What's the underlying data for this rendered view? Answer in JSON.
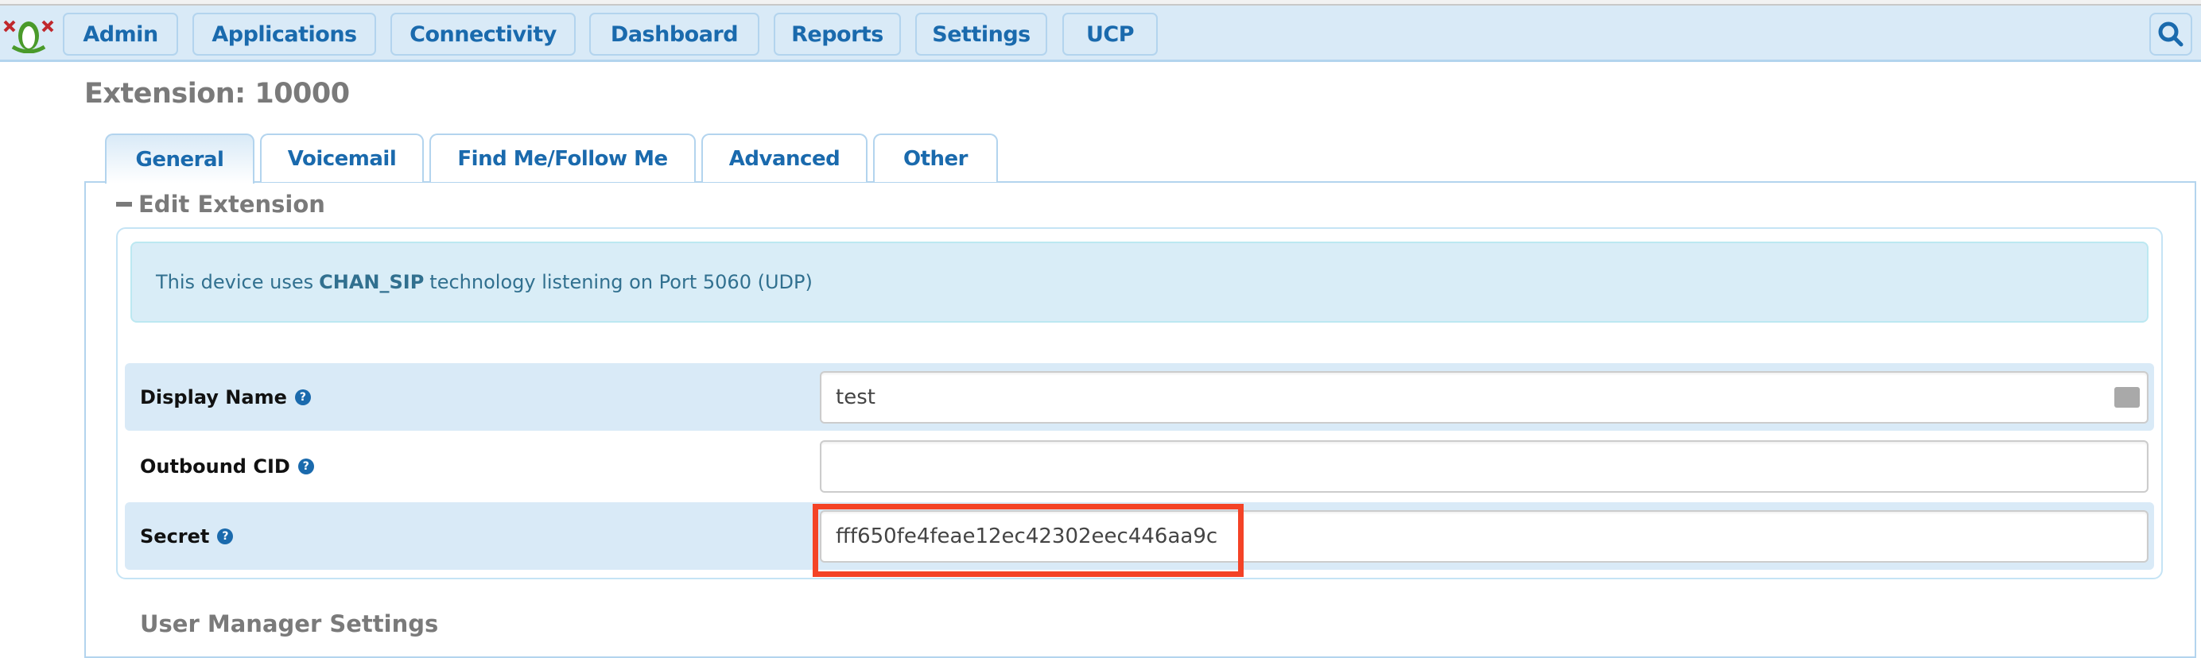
{
  "nav": {
    "items": [
      {
        "label": "Admin"
      },
      {
        "label": "Applications"
      },
      {
        "label": "Connectivity"
      },
      {
        "label": "Dashboard"
      },
      {
        "label": "Reports"
      },
      {
        "label": "Settings"
      },
      {
        "label": "UCP"
      }
    ],
    "search_icon": "search-icon",
    "logo": "freepbx-frog-logo"
  },
  "page": {
    "title": "Extension: 10000"
  },
  "tabs": [
    {
      "label": "General",
      "active": true
    },
    {
      "label": "Voicemail"
    },
    {
      "label": "Find Me/Follow Me"
    },
    {
      "label": "Advanced"
    },
    {
      "label": "Other"
    }
  ],
  "section": {
    "title": "Edit Extension",
    "next_title": "User Manager Settings"
  },
  "alert": {
    "pre": "This device uses",
    "tech": "CHAN_SIP",
    "post": "technology listening on Port 5060 (UDP)"
  },
  "fields": [
    {
      "label": "Display Name",
      "value": "test",
      "icon": "id-card-icon"
    },
    {
      "label": "Outbound CID",
      "value": ""
    },
    {
      "label": "Secret",
      "value": "fff650fe4feae12ec42302eec446aa9c",
      "highlighted": true
    }
  ],
  "colors": {
    "accent": "#1a6aad",
    "nav_bg": "#d9eaf7",
    "highlight": "#f44326"
  }
}
